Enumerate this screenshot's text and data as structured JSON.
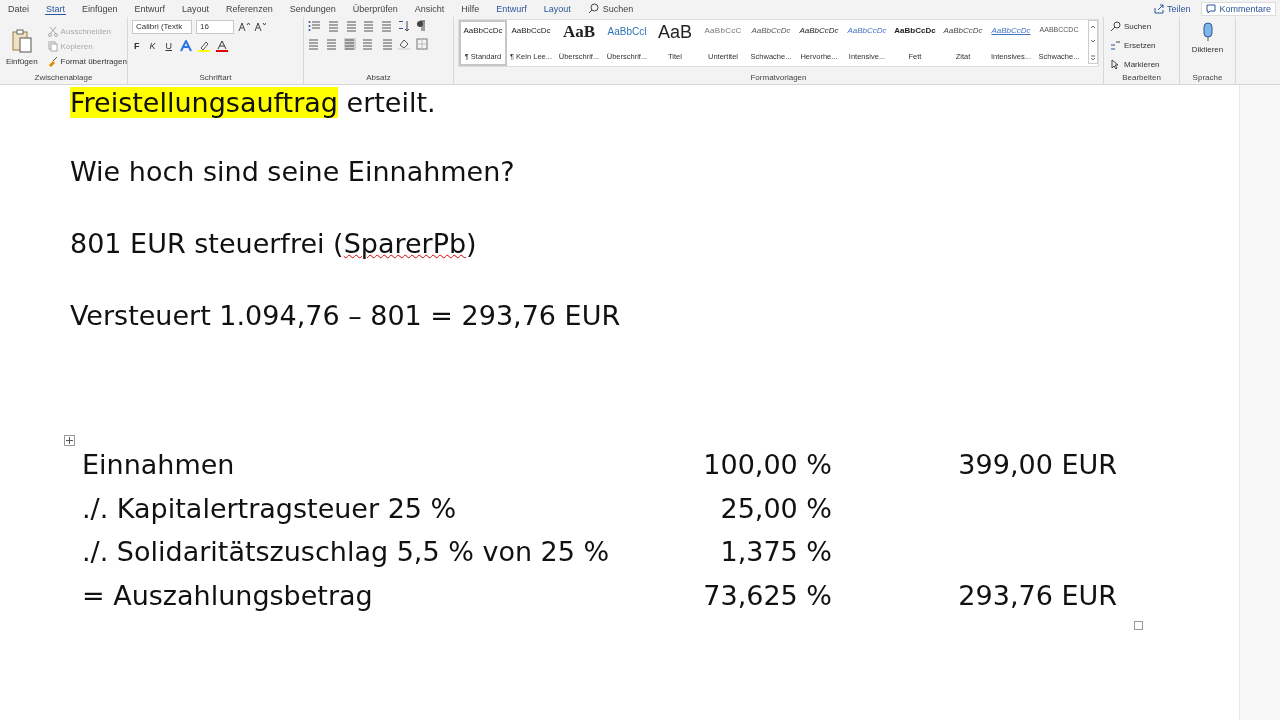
{
  "menu_tabs": [
    {
      "label": "Datei",
      "selected": false,
      "kind": "plain"
    },
    {
      "label": "Start",
      "selected": true,
      "kind": "plain"
    },
    {
      "label": "Einfügen",
      "selected": false,
      "kind": "plain"
    },
    {
      "label": "Entwurf",
      "selected": false,
      "kind": "plain"
    },
    {
      "label": "Layout",
      "selected": false,
      "kind": "plain"
    },
    {
      "label": "Referenzen",
      "selected": false,
      "kind": "plain"
    },
    {
      "label": "Sendungen",
      "selected": false,
      "kind": "plain"
    },
    {
      "label": "Überprüfen",
      "selected": false,
      "kind": "plain"
    },
    {
      "label": "Ansicht",
      "selected": false,
      "kind": "plain"
    },
    {
      "label": "Hilfe",
      "selected": false,
      "kind": "plain"
    },
    {
      "label": "Entwurf",
      "selected": false,
      "kind": "context"
    },
    {
      "label": "Layout",
      "selected": false,
      "kind": "context"
    },
    {
      "label": "Suchen",
      "selected": false,
      "kind": "search"
    }
  ],
  "share_button": "Teilen",
  "comments_button": "Kommentare",
  "clipboard": {
    "paste": "Einfügen",
    "cut": "Ausschneiden",
    "copy": "Kopieren",
    "format_painter": "Format übertragen",
    "group": "Zwischenablage"
  },
  "font": {
    "name": "Calibri (Textk",
    "size": "16",
    "bold": "F",
    "italic": "K",
    "underline": "U",
    "group": "Schriftart"
  },
  "paragraph": {
    "group": "Absatz"
  },
  "styles": {
    "group": "Formatvorlagen",
    "items": [
      {
        "preview": "AaBbCcDc",
        "name": "¶ Standard",
        "kind": "normal",
        "selected": true
      },
      {
        "preview": "AaBbCcDc",
        "name": "¶ Kein Lee...",
        "kind": "normal",
        "selected": false
      },
      {
        "preview": "AaB",
        "name": "Überschrif...",
        "kind": "heading1",
        "selected": false
      },
      {
        "preview": "AaBbCcl",
        "name": "Überschrif...",
        "kind": "heading2",
        "selected": false
      },
      {
        "preview": "AaB",
        "name": "Titel",
        "kind": "title",
        "selected": false
      },
      {
        "preview": "AaBbCcC",
        "name": "Untertitel",
        "kind": "subtitle",
        "selected": false
      },
      {
        "preview": "AaBbCcDc",
        "name": "Schwache...",
        "kind": "subtle",
        "selected": false
      },
      {
        "preview": "AaBbCcDc",
        "name": "Hervorhe...",
        "kind": "emphasis",
        "selected": false
      },
      {
        "preview": "AaBbCcDc",
        "name": "Intensive...",
        "kind": "intense",
        "selected": false
      },
      {
        "preview": "AaBbCcDc",
        "name": "Fett",
        "kind": "strong",
        "selected": false
      },
      {
        "preview": "AaBbCcDc",
        "name": "Zitat",
        "kind": "quote",
        "selected": false
      },
      {
        "preview": "AaBbCcDc",
        "name": "Intensives...",
        "kind": "intensequote",
        "selected": false
      },
      {
        "preview": "AABBCCDC",
        "name": "Schwache...",
        "kind": "subtleref",
        "selected": false
      }
    ]
  },
  "editing": {
    "find": "Suchen",
    "replace": "Ersetzen",
    "select": "Markieren",
    "group": "Bearbeiten"
  },
  "voice": {
    "dictate": "Diktieren",
    "group": "Sprache"
  },
  "document": {
    "paragraphs": [
      [
        {
          "text": "Freistellungsauftrag",
          "highlight": true,
          "misspelled": false
        },
        {
          "text": " erteilt.",
          "highlight": false,
          "misspelled": false
        }
      ],
      [
        {
          "text": "Wie hoch sind seine Einnahmen?",
          "highlight": false,
          "misspelled": false
        }
      ],
      [
        {
          "text": "801 EUR steuerfrei (",
          "highlight": false,
          "misspelled": false
        },
        {
          "text": "SparerPb",
          "highlight": false,
          "misspelled": true
        },
        {
          "text": ")",
          "highlight": false,
          "misspelled": false
        }
      ],
      [
        {
          "text": "Versteuert 1.094,76 – 801 = 293,76 EUR",
          "highlight": false,
          "misspelled": false
        }
      ]
    ],
    "table": {
      "rows": [
        [
          "Einnahmen",
          "100,00 %",
          "399,00 EUR"
        ],
        [
          "./. Kapitalertragsteuer 25 %",
          "25,00 %",
          ""
        ],
        [
          "./. Solidaritätszuschlag 5,5 % von 25 %",
          "1,375 %",
          ""
        ],
        [
          "= Auszahlungsbetrag",
          "73,625 %",
          "293,76 EUR"
        ]
      ]
    }
  }
}
